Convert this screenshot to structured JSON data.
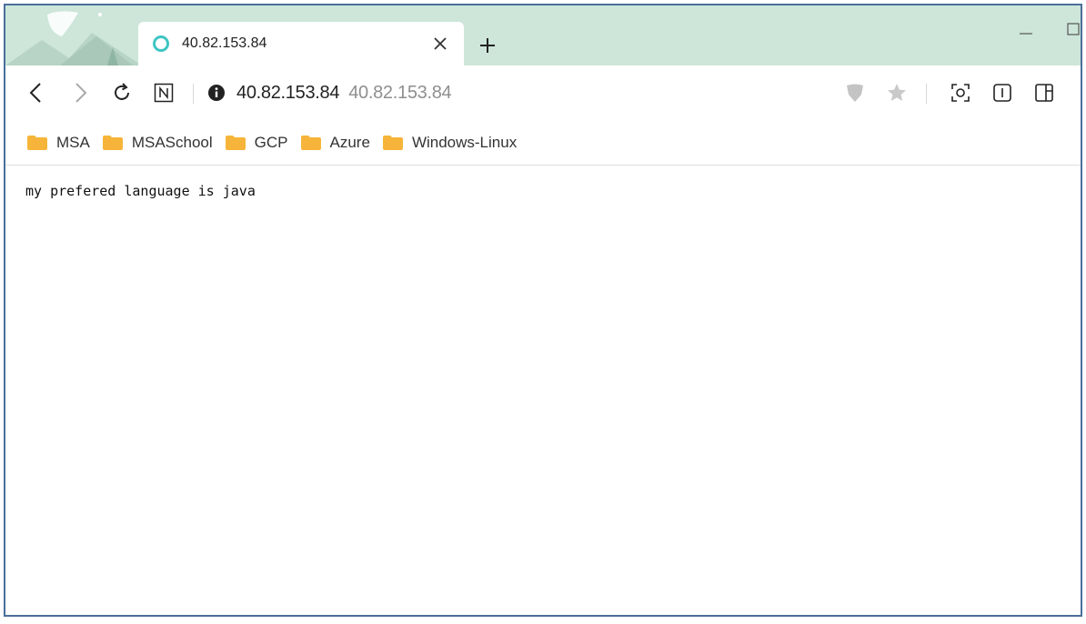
{
  "tab": {
    "title": "40.82.153.84",
    "favicon": "circle-outline-icon",
    "close": "×",
    "new_tab": "+"
  },
  "window": {
    "minimize": "—"
  },
  "toolbar": {
    "address_host": "40.82.153.84",
    "address_path": "40.82.153.84"
  },
  "bookmarks": [
    {
      "label": "MSA"
    },
    {
      "label": "MSASchool"
    },
    {
      "label": "GCP"
    },
    {
      "label": "Azure"
    },
    {
      "label": "Windows-Linux"
    }
  ],
  "page": {
    "body_text": "my prefered language is java"
  },
  "colors": {
    "tabstrip": "#cde6d9",
    "favicon": "#3fc6c3",
    "folder": "#f6b53a",
    "frame": "#4a6f9a"
  }
}
